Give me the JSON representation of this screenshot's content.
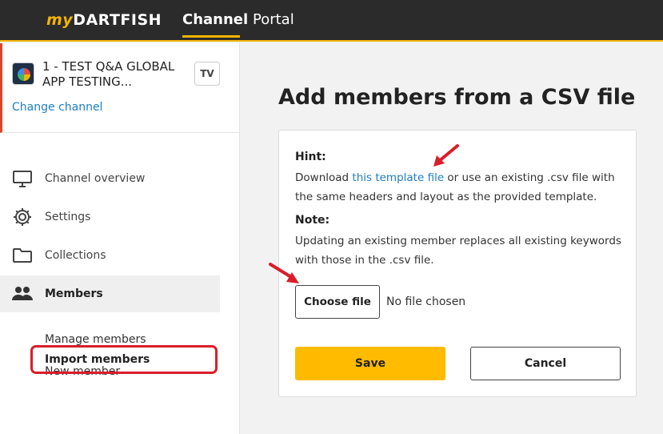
{
  "topbar": {
    "logo_prefix": "my",
    "logo_main": "DARTFISH",
    "nav": [
      {
        "label": "Channel",
        "active": true
      },
      {
        "label": "Portal",
        "active": false
      }
    ],
    "accent_color": "#f2b400"
  },
  "sidebar": {
    "channel": {
      "name": "1 - TEST Q&A GLOBAL APP TESTING...",
      "badge": "TV",
      "change_link": "Change channel"
    },
    "menu": [
      {
        "label": "Channel overview",
        "icon": "monitor-icon"
      },
      {
        "label": "Settings",
        "icon": "gear-icon"
      },
      {
        "label": "Collections",
        "icon": "folder-icon"
      },
      {
        "label": "Members",
        "icon": "people-icon",
        "active": true
      }
    ],
    "submenu": [
      {
        "label": "Manage members"
      },
      {
        "label": "New member"
      },
      {
        "label": "Import members",
        "active": true
      }
    ]
  },
  "main": {
    "title": "Add members from a CSV file",
    "hint_title": "Hint:",
    "hint_before": "Download ",
    "hint_link": "this template file",
    "hint_after": " or use an existing .csv file with the same headers and layout as the provided template.",
    "note_title": "Note:",
    "note_text": "Updating an existing member replaces all existing keywords with those in the .csv file.",
    "choose_file": "Choose file",
    "no_file": "No file chosen",
    "save": "Save",
    "cancel": "Cancel"
  },
  "colors": {
    "primary_button": "#ffbb00",
    "link": "#1b7ec2",
    "highlight_red": "#d91e2a"
  }
}
